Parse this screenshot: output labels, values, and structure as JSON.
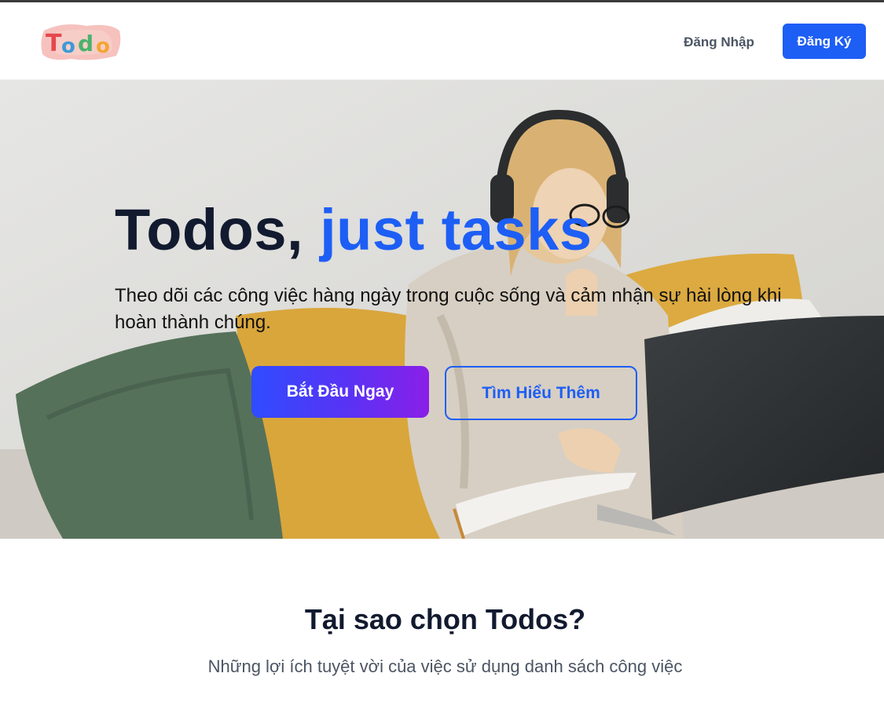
{
  "navbar": {
    "logo_text": "Todo",
    "login_label": "Đăng Nhập",
    "signup_label": "Đăng Ký"
  },
  "hero": {
    "title_main": "Todos, ",
    "title_accent": "just tasks",
    "description": "Theo dõi các công việc hàng ngày trong cuộc sống và cảm nhận sự hài lòng khi hoàn thành chúng.",
    "primary_button": "Bắt Đầu Ngay",
    "secondary_button": "Tìm Hiểu Thêm"
  },
  "why": {
    "title": "Tại sao chọn Todos?",
    "subtitle": "Những lợi ích tuyệt vời của việc sử dụng danh sách công việc"
  },
  "colors": {
    "accent": "#1d5ef5",
    "heading": "#121a2f",
    "muted_text": "#4b5563",
    "gradient_start": "#2f4cff",
    "gradient_end": "#8a1fe8"
  }
}
